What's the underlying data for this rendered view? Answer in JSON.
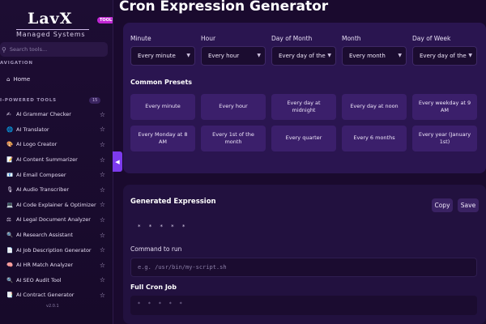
{
  "sidebar": {
    "logo_text": "LavX",
    "logo_sub": "Managed Systems",
    "badge": "TOOLS",
    "search_placeholder": "Search tools...",
    "nav_label": "AVIGATION",
    "home_label": "Home",
    "tools_label": "I-POWERED TOOLS",
    "tools_count": "15",
    "tools": [
      {
        "icon": "✍",
        "label": "AI Grammar Checker"
      },
      {
        "icon": "🌐",
        "label": "AI Translator"
      },
      {
        "icon": "🎨",
        "label": "AI Logo Creator"
      },
      {
        "icon": "📝",
        "label": "AI Content Summarizer"
      },
      {
        "icon": "📧",
        "label": "AI Email Composer"
      },
      {
        "icon": "🎙",
        "label": "AI Audio Transcriber"
      },
      {
        "icon": "💻",
        "label": "AI Code Explainer & Optimizer"
      },
      {
        "icon": "⚖",
        "label": "AI Legal Document Analyzer"
      },
      {
        "icon": "🔍",
        "label": "AI Research Assistant"
      },
      {
        "icon": "📄",
        "label": "AI Job Description Generator"
      },
      {
        "icon": "🧠",
        "label": "AI HR Match Analyzer"
      },
      {
        "icon": "🔍",
        "label": "AI SEO Audit Tool"
      },
      {
        "icon": "📑",
        "label": "AI Contract Generator"
      }
    ],
    "version": "v2.0.1"
  },
  "main": {
    "title": "Cron Expression Generator",
    "fields": [
      {
        "label": "Minute",
        "value": "Every minute"
      },
      {
        "label": "Hour",
        "value": "Every hour"
      },
      {
        "label": "Day of Month",
        "value": "Every day of the"
      },
      {
        "label": "Month",
        "value": "Every month"
      },
      {
        "label": "Day of Week",
        "value": "Every day of the"
      }
    ],
    "presets_title": "Common Presets",
    "presets": [
      "Every minute",
      "Every hour",
      "Every day at midnight",
      "Every day at noon",
      "Every weekday at 9 AM",
      "Every Monday at 8 AM",
      "Every 1st of the month",
      "Every quarter",
      "Every 6 months",
      "Every year (January 1st)"
    ],
    "generated_title": "Generated Expression",
    "copy_label": "Copy",
    "save_label": "Save",
    "expression": "* * * * *",
    "command_label": "Command to run",
    "command_placeholder": "e.g. /usr/bin/my-script.sh",
    "full_title": "Full Cron Job",
    "full_value": "* * * * *"
  }
}
